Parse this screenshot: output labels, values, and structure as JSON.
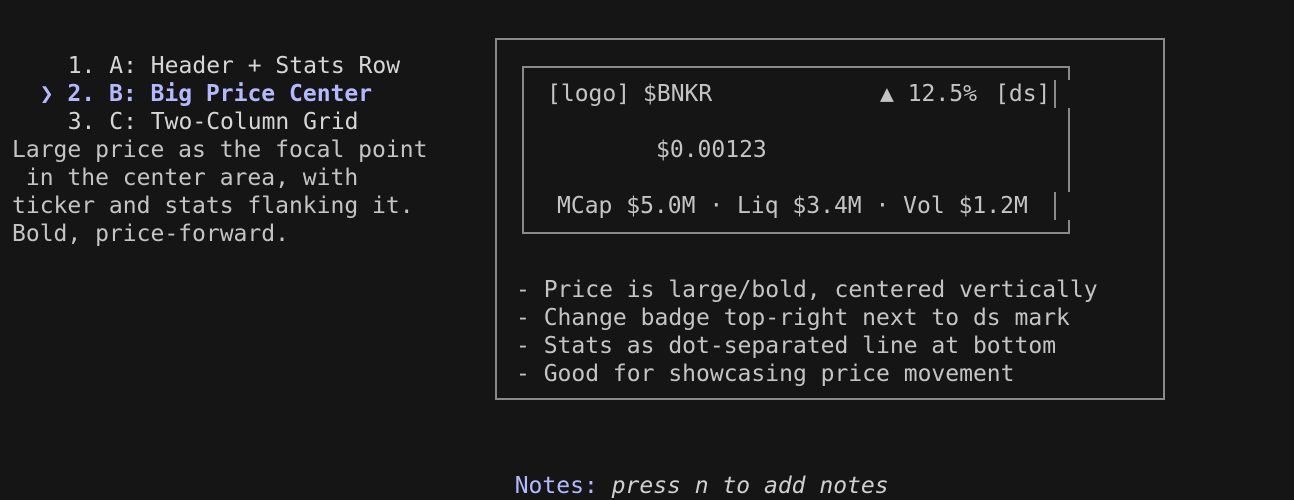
{
  "options": [
    {
      "number": "1.",
      "label": "A: Header + Stats Row",
      "selected": false
    },
    {
      "number": "2.",
      "label": "B: Big Price Center",
      "selected": true
    },
    {
      "number": "3.",
      "label": "C: Two-Column Grid",
      "selected": false
    }
  ],
  "cursor_glyph": "❯",
  "description": [
    "Large price as the focal point",
    " in the center area, with",
    "ticker and stats flanking it.",
    "Bold, price-forward."
  ],
  "preview": {
    "logo": "[logo]",
    "ticker": "$BNKR",
    "change": "▲ 12.5%",
    "ds_mark": "[ds]",
    "price": "$0.00123",
    "stats": "MCap $5.0M · Liq $3.4M · Vol $1.2M"
  },
  "bullets": [
    "- Price is large/bold, centered vertically",
    "- Change badge top-right next to ds mark",
    "- Stats as dot-separated line at bottom",
    "- Good for showcasing price movement"
  ],
  "notes": {
    "label": "Notes:",
    "hint": "press n to add notes"
  }
}
